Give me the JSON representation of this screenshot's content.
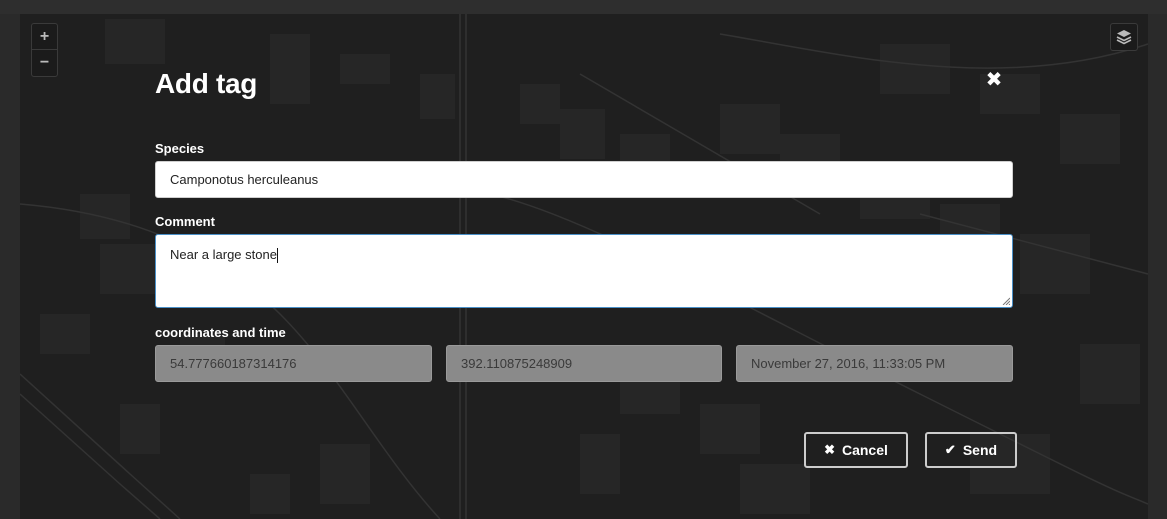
{
  "map": {
    "zoom_in_label": "+",
    "zoom_out_label": "−",
    "layers_icon": "layers-icon"
  },
  "modal": {
    "title": "Add tag",
    "close_symbol": "✖",
    "species": {
      "label": "Species",
      "value": "Camponotus herculeanus"
    },
    "comment": {
      "label": "Comment",
      "value": "Near a large stone"
    },
    "coordinates": {
      "label": "coordinates and time",
      "latitude": "54.777660187314176",
      "longitude": "392.110875248909",
      "time": "November 27, 2016, 11:33:05 PM"
    },
    "buttons": {
      "cancel_label": "Cancel",
      "cancel_icon": "✖",
      "send_label": "Send",
      "send_icon": "✔"
    }
  }
}
